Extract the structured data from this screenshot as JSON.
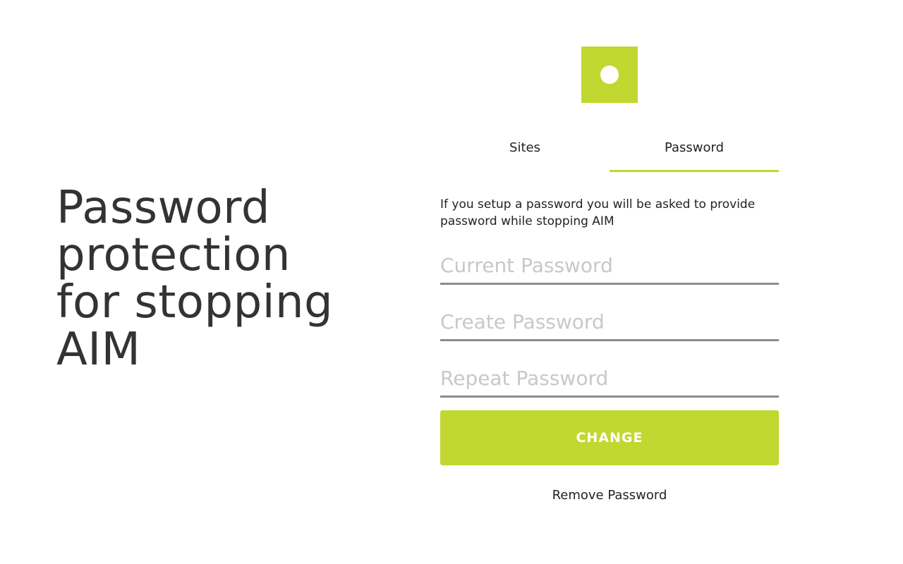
{
  "headline": {
    "line1": "Password",
    "line2": "protection",
    "line3": "for stopping",
    "line4": "AIM"
  },
  "logo": {
    "icon": "logo-circle-icon",
    "color": "#c0d82f"
  },
  "tabs": [
    {
      "label": "Sites",
      "active": false
    },
    {
      "label": "Password",
      "active": true
    }
  ],
  "info_text": "If you setup a password you will be asked to provide password while stopping AIM",
  "form": {
    "current_password": {
      "placeholder": "Current Password",
      "value": ""
    },
    "create_password": {
      "placeholder": "Create Password",
      "value": ""
    },
    "repeat_password": {
      "placeholder": "Repeat Password",
      "value": ""
    },
    "submit_label": "CHANGE"
  },
  "remove_link": "Remove Password",
  "colors": {
    "accent": "#c0d82f",
    "text": "#333333",
    "placeholder": "#c8c8c8",
    "underline": "#8c8c8c"
  }
}
